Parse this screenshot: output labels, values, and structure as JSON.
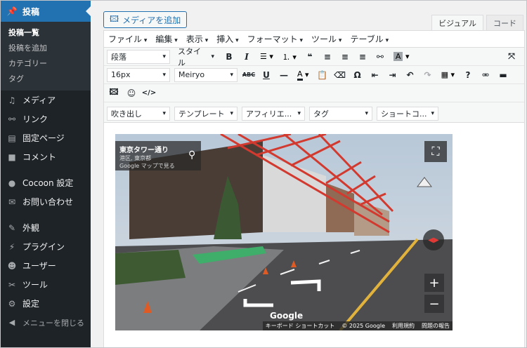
{
  "sidebar": {
    "current": "投稿",
    "sub": [
      "投稿一覧",
      "投稿を追加",
      "カテゴリー",
      "タグ"
    ],
    "items": [
      {
        "label": "メディア",
        "icon": "media-icon",
        "glyph": "♫"
      },
      {
        "label": "リンク",
        "icon": "link-icon",
        "glyph": "⚯"
      },
      {
        "label": "固定ページ",
        "icon": "page-icon",
        "glyph": "▤"
      },
      {
        "label": "コメント",
        "icon": "comment-icon",
        "glyph": "■"
      },
      {
        "label": "Cocoon 設定",
        "icon": "cocoon-icon",
        "glyph": "●"
      },
      {
        "label": "お問い合わせ",
        "icon": "mail-icon",
        "glyph": "✉"
      },
      {
        "label": "外観",
        "icon": "appearance-icon",
        "glyph": "✎"
      },
      {
        "label": "プラグイン",
        "icon": "plugin-icon",
        "glyph": "⚡"
      },
      {
        "label": "ユーザー",
        "icon": "user-icon",
        "glyph": "☻"
      },
      {
        "label": "ツール",
        "icon": "tool-icon",
        "glyph": "✂"
      },
      {
        "label": "設定",
        "icon": "settings-icon",
        "glyph": "⚙"
      }
    ],
    "collapse": "メニューを閉じる"
  },
  "editor": {
    "add_media": "メディアを追加",
    "tabs": [
      "ビジュアル",
      "コード"
    ],
    "menubar": [
      "ファイル",
      "編集",
      "表示",
      "挿入",
      "フォーマット",
      "ツール",
      "テーブル"
    ],
    "row1": {
      "paragraph": "段落",
      "style": "スタイル"
    },
    "row2": {
      "font_size": "16px",
      "font_family": "Meiryo"
    },
    "row4": [
      "吹き出し",
      "テンプレート",
      "アフィリエ...",
      "タグ",
      "ショートコ..."
    ]
  },
  "map": {
    "place": "東京タワー通り",
    "address": "港区, 東京都",
    "maps_link": "Google マップで見る",
    "logo": "Google",
    "attribution": [
      "キーボード ショートカット",
      "© 2025 Google",
      "利用規約",
      "問題の報告"
    ]
  }
}
